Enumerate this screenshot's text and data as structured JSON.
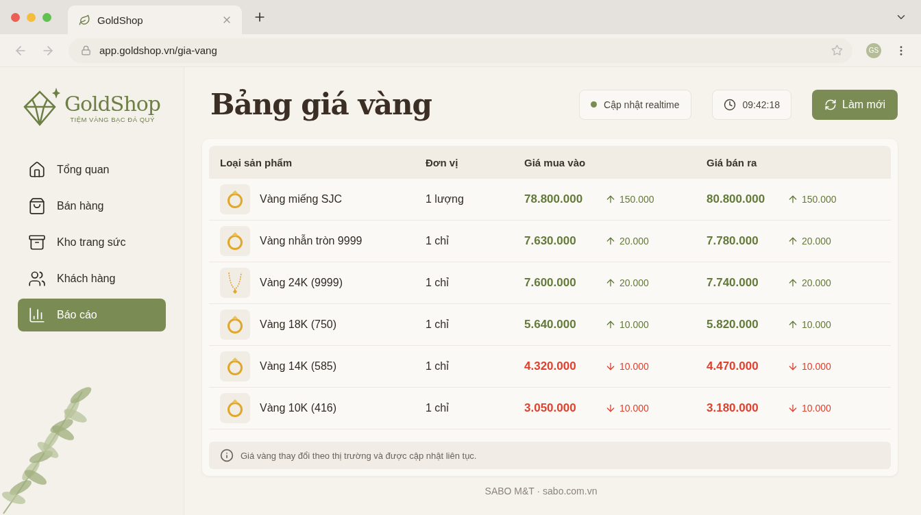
{
  "browser": {
    "tab_title": "GoldShop",
    "url": "app.goldshop.vn/gia-vang",
    "avatar": "GS"
  },
  "brand": {
    "name": "GoldShop",
    "tagline": "TIỆM VÀNG BẠC ĐÁ QUÝ"
  },
  "sidebar": {
    "items": [
      {
        "label": "Tổng quan",
        "kind": "home",
        "selected": false
      },
      {
        "label": "Bán hàng",
        "kind": "bag",
        "selected": false
      },
      {
        "label": "Kho trang sức",
        "kind": "box",
        "selected": false
      },
      {
        "label": "Khách hàng",
        "kind": "users",
        "selected": false
      },
      {
        "label": "Báo cáo",
        "kind": "chart",
        "selected": true
      }
    ]
  },
  "header": {
    "title": "Bảng giá vàng",
    "status": "Cập nhật realtime",
    "time": "09:42:18",
    "refresh": "Làm mới"
  },
  "table": {
    "columns": [
      "Loại sản phẩm",
      "Đơn vị",
      "Giá mua vào",
      "Giá bán ra"
    ],
    "rows": [
      {
        "kind": "ring",
        "name": "Vàng miếng SJC",
        "unit": "1 lượng",
        "buy": "78.800.000",
        "buy_change": "150.000",
        "sell": "80.800.000",
        "sell_change": "150.000",
        "rising": true
      },
      {
        "kind": "ring",
        "name": "Vàng nhẫn tròn 9999",
        "unit": "1 chỉ",
        "buy": "7.630.000",
        "buy_change": "20.000",
        "sell": "7.780.000",
        "sell_change": "20.000",
        "rising": true
      },
      {
        "kind": "necklace",
        "name": "Vàng 24K (9999)",
        "unit": "1 chỉ",
        "buy": "7.600.000",
        "buy_change": "20.000",
        "sell": "7.740.000",
        "sell_change": "20.000",
        "rising": true
      },
      {
        "kind": "ring",
        "name": "Vàng 18K (750)",
        "unit": "1 chỉ",
        "buy": "5.640.000",
        "buy_change": "10.000",
        "sell": "5.820.000",
        "sell_change": "10.000",
        "rising": true
      },
      {
        "kind": "ring",
        "name": "Vàng 14K (585)",
        "unit": "1 chỉ",
        "buy": "4.320.000",
        "buy_change": "10.000",
        "sell": "4.470.000",
        "sell_change": "10.000",
        "rising": false
      },
      {
        "kind": "ring",
        "name": "Vàng 10K (416)",
        "unit": "1 chỉ",
        "buy": "3.050.000",
        "buy_change": "10.000",
        "sell": "3.180.000",
        "sell_change": "10.000",
        "rising": false
      }
    ]
  },
  "note": "Giá vàng thay đổi theo thị trường và được cập nhật liên tục.",
  "footer": "SABO M&T · sabo.com.vn"
}
